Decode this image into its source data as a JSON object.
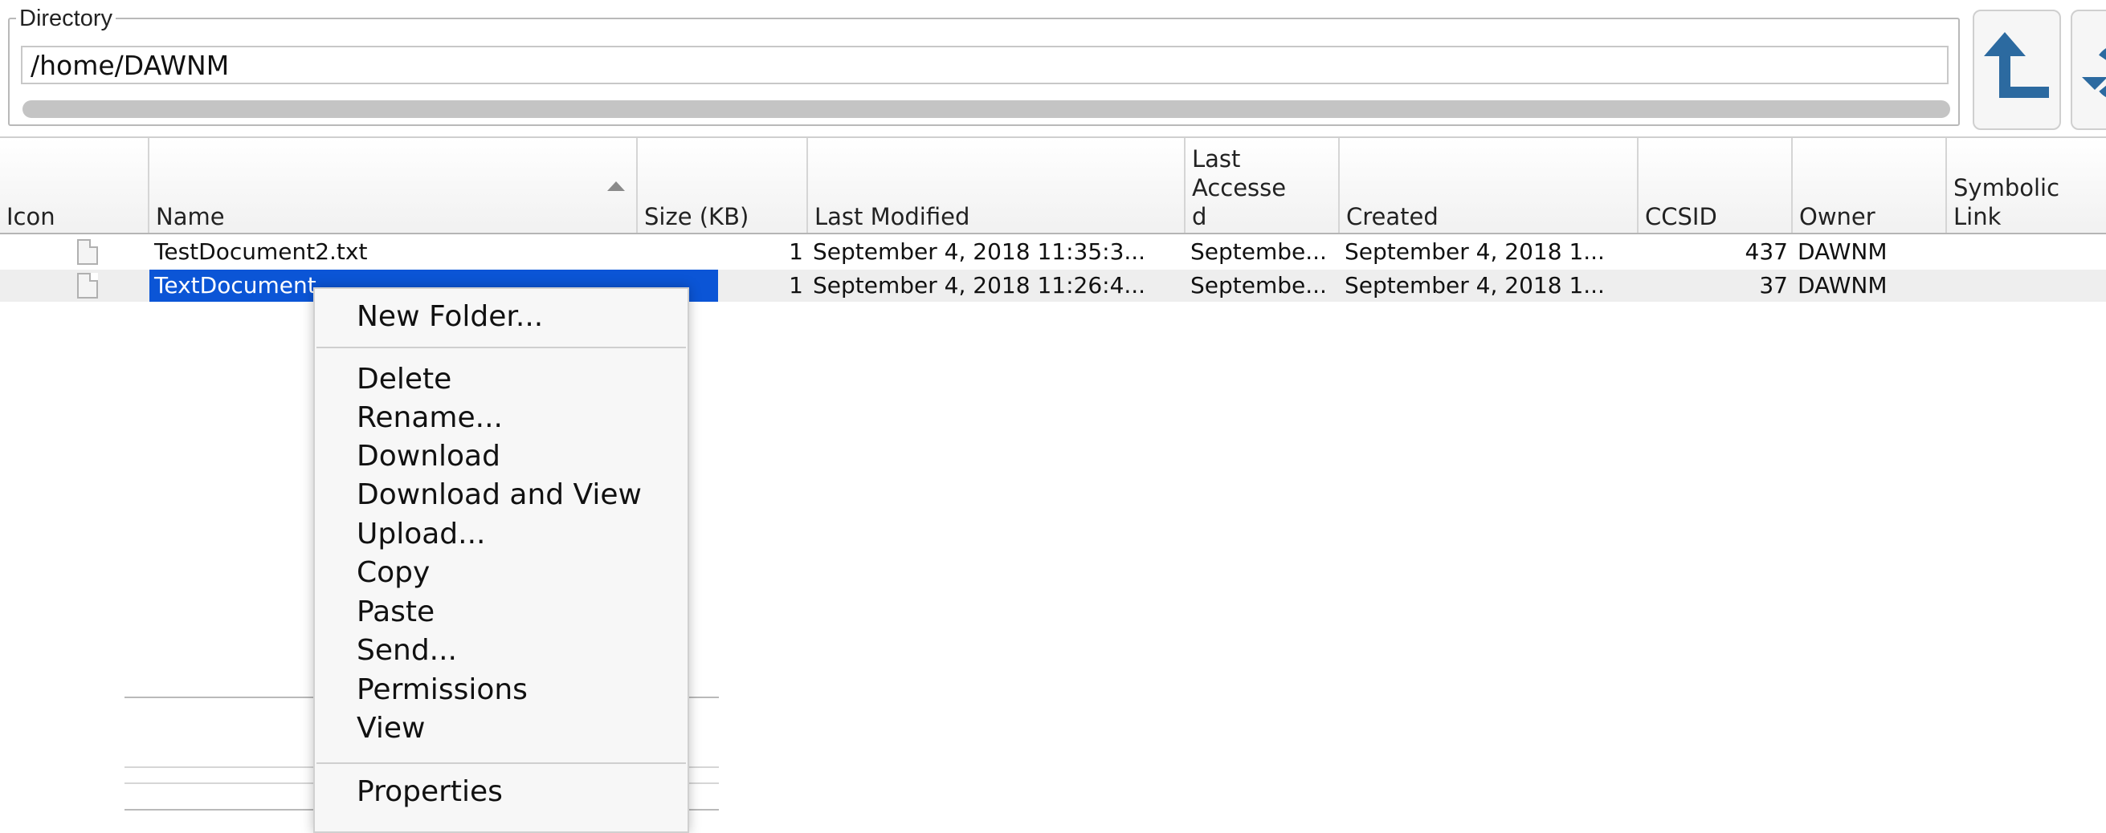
{
  "directory": {
    "legend": "Directory",
    "path": "/home/DAWNM"
  },
  "toolbar": {
    "up_icon": "arrow-up-left-icon",
    "refresh_icon": "refresh-icon"
  },
  "table": {
    "columns": [
      "Icon",
      "Name",
      "Size (KB)",
      "Last Modified",
      "Last\nAccesse\nd",
      "Created",
      "CCSID",
      "Owner",
      "Symbolic\nLink"
    ],
    "sort_column": "Name",
    "rows": [
      {
        "name": "TestDocument2.txt",
        "size": "1",
        "modified": "September 4, 2018 11:35:3...",
        "accessed": "Septembe...",
        "created": "September 4, 2018 1...",
        "ccsid": "437",
        "owner": "DAWNM",
        "link": ""
      },
      {
        "name": "TextDocument",
        "size": "1",
        "modified": "September 4, 2018 11:26:4...",
        "accessed": "Septembe...",
        "created": "September 4, 2018 1...",
        "ccsid": "37",
        "owner": "DAWNM",
        "link": ""
      }
    ],
    "selected_row": 1
  },
  "context_menu": {
    "new_folder": "New Folder...",
    "delete": "Delete",
    "rename": "Rename...",
    "download": "Download",
    "download_view": "Download and View",
    "upload": "Upload...",
    "copy": "Copy",
    "paste": "Paste",
    "send": "Send...",
    "permissions": "Permissions",
    "view": "View",
    "properties": "Properties"
  },
  "colors": {
    "selection": "#0b55d6",
    "icon_blue": "#2c6aa0"
  }
}
